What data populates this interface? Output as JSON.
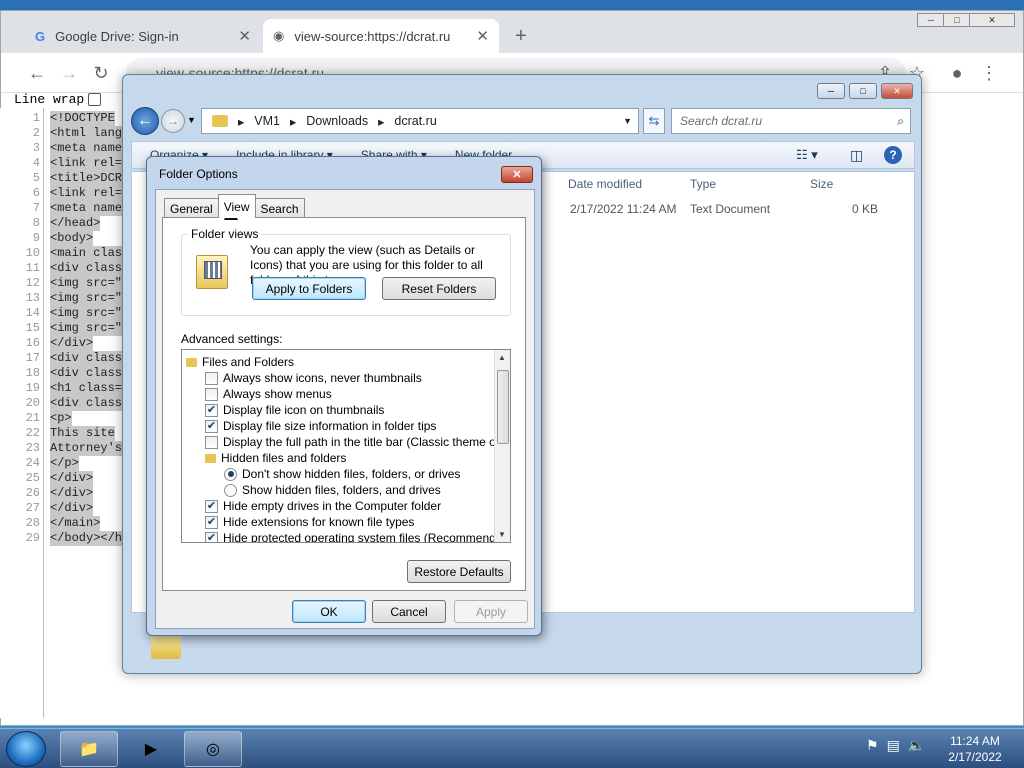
{
  "browser": {
    "tabs": [
      {
        "label": "Google Drive: Sign-in",
        "icon": "google-icon"
      },
      {
        "label": "view-source:https://dcrat.ru",
        "icon": "globe-icon"
      }
    ],
    "address": "view-source:https://dcrat.ru",
    "line_wrap_label": "Line wrap",
    "source_lines": [
      {
        "n": "1",
        "code": "<!DOCTYPE"
      },
      {
        "n": "2",
        "code": "<html lang"
      },
      {
        "n": "3",
        "code": "<meta name"
      },
      {
        "n": "4",
        "code": "<link rel="
      },
      {
        "n": "5",
        "code": "<title>DCR"
      },
      {
        "n": "6",
        "code": "<link rel="
      },
      {
        "n": "7",
        "code": "<meta name"
      },
      {
        "n": "8",
        "code": "</head>"
      },
      {
        "n": "9",
        "code": "<body>"
      },
      {
        "n": "10",
        "code": "<main clas"
      },
      {
        "n": "11",
        "code": "<div class"
      },
      {
        "n": "12",
        "code": "<img src=\""
      },
      {
        "n": "13",
        "code": "<img src=\""
      },
      {
        "n": "14",
        "code": "<img src=\""
      },
      {
        "n": "15",
        "code": "<img src=\""
      },
      {
        "n": "16",
        "code": "</div>"
      },
      {
        "n": "17",
        "code": "<div class"
      },
      {
        "n": "18",
        "code": "<div class"
      },
      {
        "n": "19",
        "code": "<h1 class="
      },
      {
        "n": "20",
        "code": "<div class"
      },
      {
        "n": "21",
        "code": "<p>"
      },
      {
        "n": "22",
        "code": "This site"
      },
      {
        "n": "23",
        "code": "Attorney's"
      },
      {
        "n": "24",
        "code": "</p>"
      },
      {
        "n": "25",
        "code": "</div>"
      },
      {
        "n": "26",
        "code": "</div>"
      },
      {
        "n": "27",
        "code": "</div>"
      },
      {
        "n": "28",
        "code": "</main>"
      },
      {
        "n": "29",
        "code": "</body></h"
      }
    ]
  },
  "explorer": {
    "breadcrumb": [
      "VM1",
      "Downloads",
      "dcrat.ru"
    ],
    "search_placeholder": "Search dcrat.ru",
    "commands": [
      "Organize ▾",
      "Include in library ▾",
      "Share with ▾",
      "New folder"
    ],
    "columns": {
      "date": "Date modified",
      "type": "Type",
      "size": "Size"
    },
    "file": {
      "date": "2/17/2022 11:24 AM",
      "type": "Text Document",
      "size": "0 KB"
    }
  },
  "dialog": {
    "title": "Folder Options",
    "tabs": [
      "General",
      "View",
      "Search"
    ],
    "active_tab": "View",
    "folder_views": {
      "label": "Folder views",
      "text": "You can apply the view (such as Details or Icons) that you are using for this folder to all folders of this type.",
      "apply_button": "Apply to Folders",
      "reset_button": "Reset Folders"
    },
    "advanced_label": "Advanced settings:",
    "tree": [
      {
        "kind": "folder",
        "label": "Files and Folders",
        "indent": 0
      },
      {
        "kind": "check",
        "label": "Always show icons, never thumbnails",
        "checked": false,
        "indent": 1
      },
      {
        "kind": "check",
        "label": "Always show menus",
        "checked": false,
        "indent": 1
      },
      {
        "kind": "check",
        "label": "Display file icon on thumbnails",
        "checked": true,
        "indent": 1
      },
      {
        "kind": "check",
        "label": "Display file size information in folder tips",
        "checked": true,
        "indent": 1
      },
      {
        "kind": "check",
        "label": "Display the full path in the title bar (Classic theme only)",
        "checked": false,
        "indent": 1
      },
      {
        "kind": "folder",
        "label": "Hidden files and folders",
        "indent": 1
      },
      {
        "kind": "radio",
        "label": "Don't show hidden files, folders, or drives",
        "checked": true,
        "indent": 2
      },
      {
        "kind": "radio",
        "label": "Show hidden files, folders, and drives",
        "checked": false,
        "indent": 2
      },
      {
        "kind": "check",
        "label": "Hide empty drives in the Computer folder",
        "checked": true,
        "indent": 1
      },
      {
        "kind": "check",
        "label": "Hide extensions for known file types",
        "checked": true,
        "indent": 1
      },
      {
        "kind": "check",
        "label": "Hide protected operating system files (Recommended)",
        "checked": true,
        "indent": 1
      }
    ],
    "restore_button": "Restore Defaults",
    "ok_button": "OK",
    "cancel_button": "Cancel",
    "apply_button": "Apply"
  },
  "taskbar": {
    "time": "11:24 AM",
    "date": "2/17/2022"
  }
}
